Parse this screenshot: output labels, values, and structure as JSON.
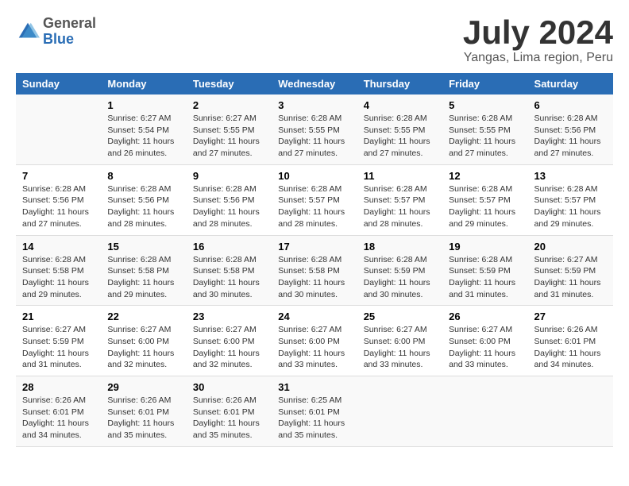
{
  "header": {
    "logo_general": "General",
    "logo_blue": "Blue",
    "title": "July 2024",
    "subtitle": "Yangas, Lima region, Peru"
  },
  "days_of_week": [
    "Sunday",
    "Monday",
    "Tuesday",
    "Wednesday",
    "Thursday",
    "Friday",
    "Saturday"
  ],
  "weeks": [
    [
      {
        "day": "",
        "info": ""
      },
      {
        "day": "1",
        "info": "Sunrise: 6:27 AM\nSunset: 5:54 PM\nDaylight: 11 hours\nand 26 minutes."
      },
      {
        "day": "2",
        "info": "Sunrise: 6:27 AM\nSunset: 5:55 PM\nDaylight: 11 hours\nand 27 minutes."
      },
      {
        "day": "3",
        "info": "Sunrise: 6:28 AM\nSunset: 5:55 PM\nDaylight: 11 hours\nand 27 minutes."
      },
      {
        "day": "4",
        "info": "Sunrise: 6:28 AM\nSunset: 5:55 PM\nDaylight: 11 hours\nand 27 minutes."
      },
      {
        "day": "5",
        "info": "Sunrise: 6:28 AM\nSunset: 5:55 PM\nDaylight: 11 hours\nand 27 minutes."
      },
      {
        "day": "6",
        "info": "Sunrise: 6:28 AM\nSunset: 5:56 PM\nDaylight: 11 hours\nand 27 minutes."
      }
    ],
    [
      {
        "day": "7",
        "info": "Sunrise: 6:28 AM\nSunset: 5:56 PM\nDaylight: 11 hours\nand 27 minutes."
      },
      {
        "day": "8",
        "info": "Sunrise: 6:28 AM\nSunset: 5:56 PM\nDaylight: 11 hours\nand 28 minutes."
      },
      {
        "day": "9",
        "info": "Sunrise: 6:28 AM\nSunset: 5:56 PM\nDaylight: 11 hours\nand 28 minutes."
      },
      {
        "day": "10",
        "info": "Sunrise: 6:28 AM\nSunset: 5:57 PM\nDaylight: 11 hours\nand 28 minutes."
      },
      {
        "day": "11",
        "info": "Sunrise: 6:28 AM\nSunset: 5:57 PM\nDaylight: 11 hours\nand 28 minutes."
      },
      {
        "day": "12",
        "info": "Sunrise: 6:28 AM\nSunset: 5:57 PM\nDaylight: 11 hours\nand 29 minutes."
      },
      {
        "day": "13",
        "info": "Sunrise: 6:28 AM\nSunset: 5:57 PM\nDaylight: 11 hours\nand 29 minutes."
      }
    ],
    [
      {
        "day": "14",
        "info": "Sunrise: 6:28 AM\nSunset: 5:58 PM\nDaylight: 11 hours\nand 29 minutes."
      },
      {
        "day": "15",
        "info": "Sunrise: 6:28 AM\nSunset: 5:58 PM\nDaylight: 11 hours\nand 29 minutes."
      },
      {
        "day": "16",
        "info": "Sunrise: 6:28 AM\nSunset: 5:58 PM\nDaylight: 11 hours\nand 30 minutes."
      },
      {
        "day": "17",
        "info": "Sunrise: 6:28 AM\nSunset: 5:58 PM\nDaylight: 11 hours\nand 30 minutes."
      },
      {
        "day": "18",
        "info": "Sunrise: 6:28 AM\nSunset: 5:59 PM\nDaylight: 11 hours\nand 30 minutes."
      },
      {
        "day": "19",
        "info": "Sunrise: 6:28 AM\nSunset: 5:59 PM\nDaylight: 11 hours\nand 31 minutes."
      },
      {
        "day": "20",
        "info": "Sunrise: 6:27 AM\nSunset: 5:59 PM\nDaylight: 11 hours\nand 31 minutes."
      }
    ],
    [
      {
        "day": "21",
        "info": "Sunrise: 6:27 AM\nSunset: 5:59 PM\nDaylight: 11 hours\nand 31 minutes."
      },
      {
        "day": "22",
        "info": "Sunrise: 6:27 AM\nSunset: 6:00 PM\nDaylight: 11 hours\nand 32 minutes."
      },
      {
        "day": "23",
        "info": "Sunrise: 6:27 AM\nSunset: 6:00 PM\nDaylight: 11 hours\nand 32 minutes."
      },
      {
        "day": "24",
        "info": "Sunrise: 6:27 AM\nSunset: 6:00 PM\nDaylight: 11 hours\nand 33 minutes."
      },
      {
        "day": "25",
        "info": "Sunrise: 6:27 AM\nSunset: 6:00 PM\nDaylight: 11 hours\nand 33 minutes."
      },
      {
        "day": "26",
        "info": "Sunrise: 6:27 AM\nSunset: 6:00 PM\nDaylight: 11 hours\nand 33 minutes."
      },
      {
        "day": "27",
        "info": "Sunrise: 6:26 AM\nSunset: 6:01 PM\nDaylight: 11 hours\nand 34 minutes."
      }
    ],
    [
      {
        "day": "28",
        "info": "Sunrise: 6:26 AM\nSunset: 6:01 PM\nDaylight: 11 hours\nand 34 minutes."
      },
      {
        "day": "29",
        "info": "Sunrise: 6:26 AM\nSunset: 6:01 PM\nDaylight: 11 hours\nand 35 minutes."
      },
      {
        "day": "30",
        "info": "Sunrise: 6:26 AM\nSunset: 6:01 PM\nDaylight: 11 hours\nand 35 minutes."
      },
      {
        "day": "31",
        "info": "Sunrise: 6:25 AM\nSunset: 6:01 PM\nDaylight: 11 hours\nand 35 minutes."
      },
      {
        "day": "",
        "info": ""
      },
      {
        "day": "",
        "info": ""
      },
      {
        "day": "",
        "info": ""
      }
    ]
  ]
}
